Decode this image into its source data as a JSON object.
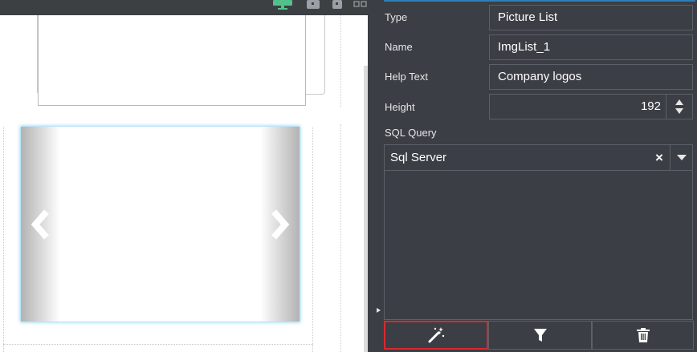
{
  "properties": {
    "type_label": "Type",
    "type_value": "Picture List",
    "name_label": "Name",
    "name_value": "ImgList_1",
    "help_label": "Help Text",
    "help_value": "Company logos",
    "height_label": "Height",
    "height_value": "192",
    "sql_label": "SQL Query",
    "sql_provider": "Sql Server",
    "sql_text": ""
  },
  "colors": {
    "panel_bg": "#3b3e44",
    "accent": "#2d7fb9",
    "desktop_icon": "#52c08a",
    "highlight": "#d9282f",
    "carousel_glow": "#8fd3f2"
  },
  "icons": {
    "toolbar_device": [
      "desktop-icon",
      "tablet-icon",
      "phone-icon",
      "grid-icon"
    ],
    "carousel": [
      "chevron-left-icon",
      "chevron-right-icon"
    ],
    "height_spinner": "up-down-arrows-icon",
    "sql_select": [
      "clear-x-icon",
      "caret-down-icon"
    ],
    "bottom_toolbar": [
      "magic-wand-icon",
      "filter-icon",
      "trash-icon"
    ]
  },
  "sql_clear_glyph": "×"
}
